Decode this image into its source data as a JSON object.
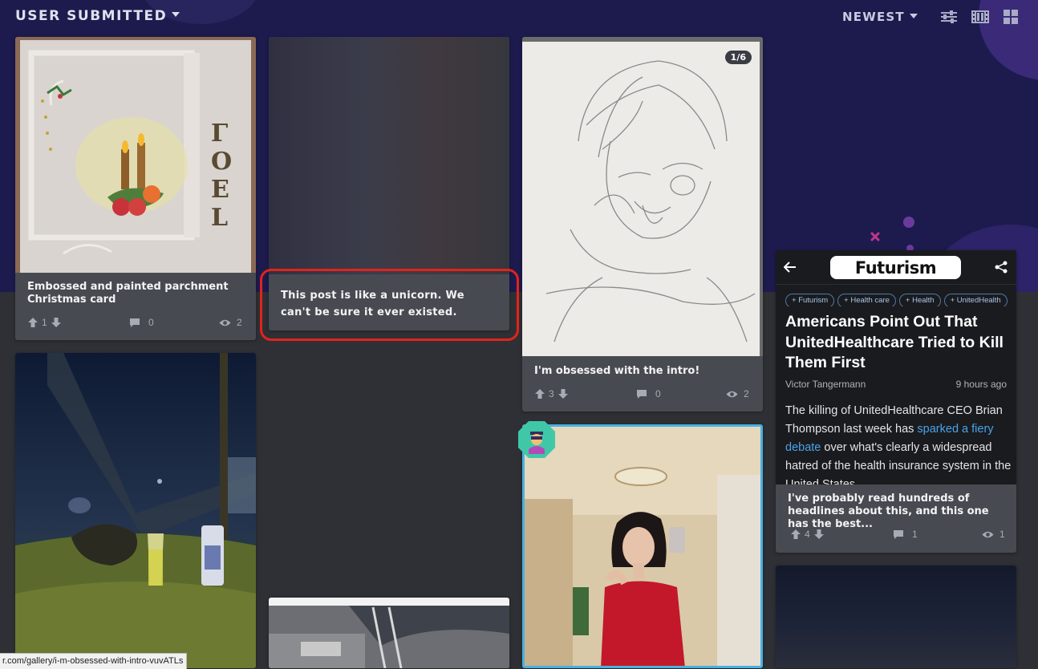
{
  "header": {
    "section_label": "USER SUBMITTED",
    "sort_label": "NEWEST",
    "icons": [
      "filter-sliders-icon",
      "film-strip-icon",
      "grid-icon"
    ]
  },
  "posts": [
    {
      "title": "Embossed and painted parchment Christmas card",
      "upvotes": "1",
      "comments": "0",
      "views": "2"
    },
    {
      "title": "This post is like a unicorn. We can't be sure it ever existed."
    },
    {
      "title": "I'm obsessed with the intro!",
      "pagination": "1/6",
      "upvotes": "3",
      "comments": "0",
      "views": "2"
    }
  ],
  "ad_card": {
    "logo": "Futurism",
    "tags": [
      "Futurism",
      "Health care",
      "Health",
      "UnitedHealth"
    ],
    "headline": "Americans Point Out That UnitedHealthcare Tried to Kill Them First",
    "author": "Victor Tangermann",
    "time": "9 hours ago",
    "body_pre": "The killing of UnitedHealthcare CEO Brian Thompson last week has ",
    "body_link": "sparked a fiery debate",
    "body_post": " over what's clearly a widespread hatred of the health insurance system in the United States.",
    "caption": "I've probably read hundreds of headlines about this, and this one has the best...",
    "upvotes": "4",
    "comments": "1",
    "views": "1"
  },
  "status_url": "r.com/gallery/i-m-obsessed-with-intro-vuvATLs",
  "colors": {
    "hero_bg": "#1d1b4e",
    "page_bg": "#2e3035",
    "card_bg": "#474a51",
    "highlight": "#e3231b",
    "link": "#4aa3e8"
  }
}
